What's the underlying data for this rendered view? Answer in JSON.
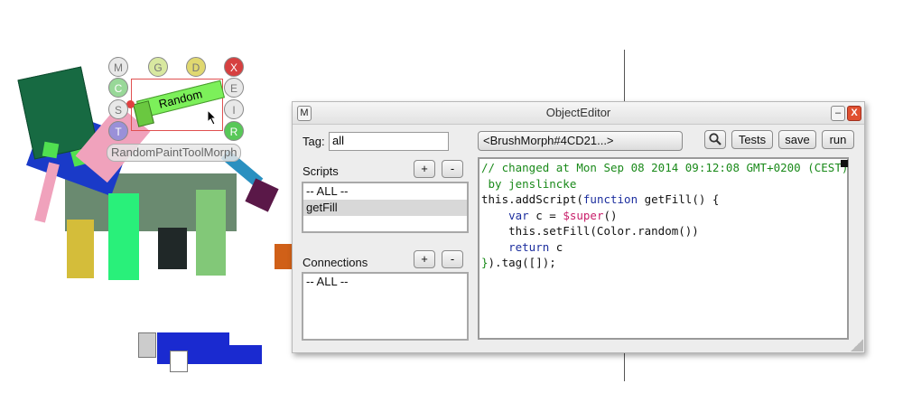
{
  "world": {
    "morph_label": "RandomPaintToolMorph",
    "morph_text": "Random",
    "halo_handles": [
      {
        "letter": "M",
        "name": "menu",
        "color": "#e8e8e8"
      },
      {
        "letter": "G",
        "name": "grab",
        "color": "#d8e8a0"
      },
      {
        "letter": "D",
        "name": "duplicate",
        "color": "#e0d870"
      },
      {
        "letter": "X",
        "name": "close",
        "color": "#d64040"
      },
      {
        "letter": "C",
        "name": "copy",
        "color": "#98d898"
      },
      {
        "letter": "E",
        "name": "edit",
        "color": "#e8e8e8"
      },
      {
        "letter": "S",
        "name": "scale",
        "color": "#e8e8e8"
      },
      {
        "letter": "I",
        "name": "inspect",
        "color": "#e8e8e8"
      },
      {
        "letter": "T",
        "name": "tag",
        "color": "#9a90d8"
      },
      {
        "letter": "R",
        "name": "rotate",
        "color": "#58c858"
      }
    ]
  },
  "editor": {
    "window_title": "ObjectEditor",
    "menu_button": "M",
    "minimize_button": "–",
    "close_button": "X",
    "tag_label": "Tag:",
    "tag_value": "all",
    "target_value": "<BrushMorph#4CD21...>",
    "buttons": {
      "search_icon": "magnifier-icon",
      "tests": "Tests",
      "save": "save",
      "run": "run"
    },
    "scripts": {
      "label": "Scripts",
      "add": "+",
      "remove": "-",
      "items": [
        "-- ALL --",
        "getFill"
      ],
      "selected": "getFill"
    },
    "connections": {
      "label": "Connections",
      "add": "+",
      "remove": "-",
      "items": [
        "-- ALL --"
      ]
    },
    "code": {
      "comment_line1": "// changed at Mon Sep 08 2014 09:12:08 GMT+0200 (CEST)",
      "comment_line2": " by jenslincke",
      "line3a": "this.addScript(",
      "line3b": "function",
      "line3c": " getFill() {",
      "line4a": "    ",
      "line4b": "var",
      "line4c": " c = ",
      "line4d": "$super",
      "line4e": "()",
      "line5": "    this.setFill(Color.random())",
      "line6a": "    ",
      "line6b": "return",
      "line6c": " c",
      "line7a": "}",
      "line7b": ").tag([]);"
    }
  },
  "colors": {
    "dark_green": "#176a42",
    "blue": "#1a3ac8",
    "gray_green": "#6a8a70",
    "mustard": "#d4bd3a",
    "mint": "#29f07a",
    "charcoal": "#202828",
    "light_green": "#82c878",
    "pink": "#f0a2bc",
    "steel_blue": "#2a90c0",
    "purple": "#5a1848",
    "orange": "#d06018",
    "random_bar": "#7cf05a"
  }
}
